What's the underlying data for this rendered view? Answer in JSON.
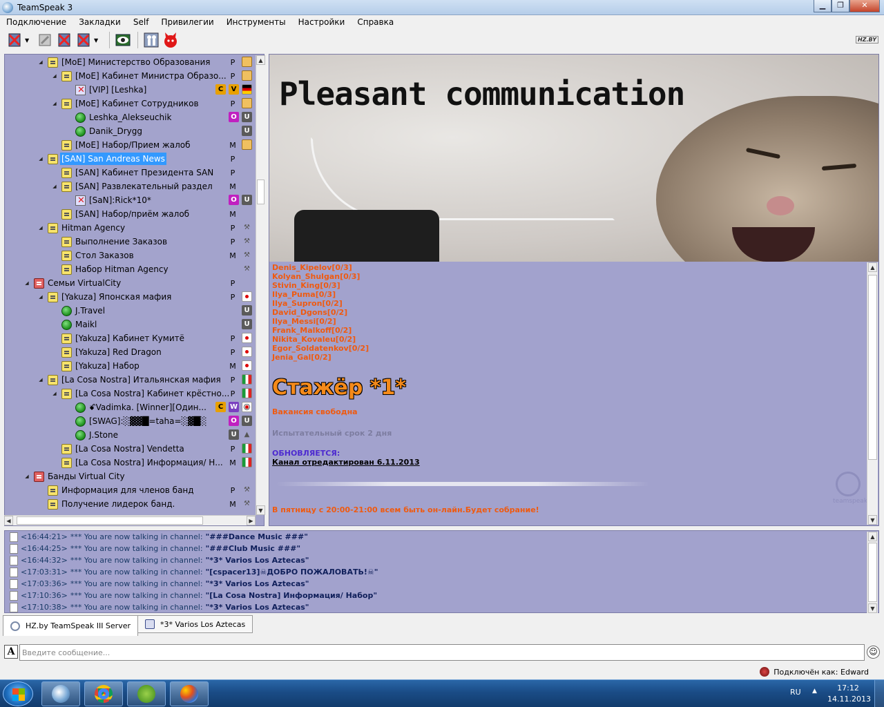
{
  "window": {
    "title": "TeamSpeak 3",
    "minimize": "▁",
    "maximize": "❐",
    "close": "✕"
  },
  "menu": [
    "Подключение",
    "Закладки",
    "Self",
    "Привилегии",
    "Инструменты",
    "Настройки",
    "Справка"
  ],
  "toolbar": {
    "logo_text": "HZ.BY"
  },
  "tree": [
    {
      "label": "[MoE] Министерство Образования",
      "type": "channel",
      "depth": 3,
      "expand": "open",
      "flag": "P",
      "badges": [
        "clip"
      ]
    },
    {
      "label": "[MoE] Кабинет Министра Образо...",
      "type": "channel",
      "depth": 4,
      "expand": "open",
      "flag": "P",
      "badges": [
        "clip"
      ]
    },
    {
      "label": "[VIP] [Leshka]",
      "type": "muted",
      "depth": 5,
      "expand": "",
      "flag": "",
      "badges": [
        "c",
        "v",
        "de"
      ]
    },
    {
      "label": "[MoE] Кабинет Сотрудников",
      "type": "channel",
      "depth": 4,
      "expand": "open",
      "flag": "P",
      "badges": [
        "clip"
      ]
    },
    {
      "label": "Leshka_Alekseuchik",
      "type": "user",
      "depth": 5,
      "expand": "",
      "flag": "",
      "badges": [
        "o",
        "u"
      ]
    },
    {
      "label": "Danik_Drygg",
      "type": "user",
      "depth": 5,
      "expand": "",
      "flag": "",
      "badges": [
        "u"
      ]
    },
    {
      "label": "[MoE] Набор/Прием жалоб",
      "type": "channel",
      "depth": 4,
      "expand": "",
      "flag": "M",
      "badges": [
        "clip"
      ]
    },
    {
      "label": "[SAN] San Andreas News",
      "type": "channel",
      "depth": 3,
      "expand": "open",
      "flag": "P",
      "badges": [],
      "selected": true
    },
    {
      "label": "[SAN] Кабинет Президента SAN",
      "type": "channel",
      "depth": 4,
      "expand": "",
      "flag": "P",
      "badges": []
    },
    {
      "label": "[SAN] Развлекательный раздел",
      "type": "channel",
      "depth": 4,
      "expand": "open",
      "flag": "M",
      "badges": []
    },
    {
      "label": "[SaN]:Rick*10*",
      "type": "muted",
      "depth": 5,
      "expand": "",
      "flag": "",
      "badges": [
        "o",
        "u"
      ]
    },
    {
      "label": "[SAN] Набор/приём жалоб",
      "type": "channel",
      "depth": 4,
      "expand": "",
      "flag": "M",
      "badges": []
    },
    {
      "label": "Hitman Agency",
      "type": "channel",
      "depth": 3,
      "expand": "open",
      "flag": "P",
      "badges": [
        "gun"
      ]
    },
    {
      "label": "Выполнение Заказов",
      "type": "channel",
      "depth": 4,
      "expand": "",
      "flag": "P",
      "badges": [
        "gun"
      ]
    },
    {
      "label": "Стол Заказов",
      "type": "channel",
      "depth": 4,
      "expand": "",
      "flag": "M",
      "badges": [
        "gun"
      ]
    },
    {
      "label": "Набор Hitman Agency",
      "type": "channel",
      "depth": 4,
      "expand": "",
      "flag": "",
      "badges": [
        "gun"
      ]
    },
    {
      "label": "Семьи VirtualCity",
      "type": "channel-red",
      "depth": 2,
      "expand": "open",
      "flag": "P",
      "badges": []
    },
    {
      "label": "[Yakuza] Японская мафия",
      "type": "channel",
      "depth": 3,
      "expand": "open",
      "flag": "P",
      "badges": [
        "jp"
      ]
    },
    {
      "label": "J.Travel",
      "type": "user",
      "depth": 4,
      "expand": "",
      "flag": "",
      "badges": [
        "u"
      ]
    },
    {
      "label": "Maikl",
      "type": "user",
      "depth": 4,
      "expand": "",
      "flag": "",
      "badges": [
        "u"
      ]
    },
    {
      "label": "[Yakuza] Кабинет Кумитё",
      "type": "channel",
      "depth": 4,
      "expand": "",
      "flag": "P",
      "badges": [
        "jp"
      ]
    },
    {
      "label": "[Yakuza] Red Dragon",
      "type": "channel",
      "depth": 4,
      "expand": "",
      "flag": "P",
      "badges": [
        "jp"
      ]
    },
    {
      "label": "[Yakuza] Набор",
      "type": "channel",
      "depth": 4,
      "expand": "",
      "flag": "M",
      "badges": [
        "jp"
      ]
    },
    {
      "label": "[La Cosa Nostra] Итальянская мафия",
      "type": "channel",
      "depth": 3,
      "expand": "open",
      "flag": "P",
      "badges": [
        "it"
      ]
    },
    {
      "label": "[La Cosa Nostra] Кабинет крёстно...",
      "type": "channel",
      "depth": 4,
      "expand": "open",
      "flag": "P",
      "badges": [
        "it"
      ]
    },
    {
      "label": "ꗄVadimka. [Winner][Один...",
      "type": "user",
      "depth": 5,
      "expand": "",
      "flag": "",
      "badges": [
        "c",
        "w",
        "smile"
      ]
    },
    {
      "label": "[SWAG]:░▓▓█=taha=░▓█░",
      "type": "user",
      "depth": 5,
      "expand": "",
      "flag": "",
      "badges": [
        "o",
        "u"
      ]
    },
    {
      "label": "J.Stone",
      "type": "user",
      "depth": 5,
      "expand": "",
      "flag": "",
      "badges": [
        "u",
        "warn"
      ]
    },
    {
      "label": "[La Cosa Nostra] Vendetta",
      "type": "channel",
      "depth": 4,
      "expand": "",
      "flag": "P",
      "badges": [
        "it"
      ]
    },
    {
      "label": "[La Cosa Nostra] Информация/ Н...",
      "type": "channel",
      "depth": 4,
      "expand": "",
      "flag": "M",
      "badges": [
        "it"
      ]
    },
    {
      "label": "Банды Virtual City",
      "type": "channel-red",
      "depth": 2,
      "expand": "open",
      "flag": "",
      "badges": []
    },
    {
      "label": "Информация для членов банд",
      "type": "channel",
      "depth": 3,
      "expand": "",
      "flag": "P",
      "badges": [
        "gun"
      ]
    },
    {
      "label": "Получение лидерок банд.",
      "type": "channel",
      "depth": 3,
      "expand": "",
      "flag": "M",
      "badges": [
        "gun"
      ]
    }
  ],
  "badge_text": {
    "o": "O",
    "u": "U",
    "c": "C",
    "v": "V",
    "w": "W",
    "gun": "⚒",
    "smile": "☺",
    "warn": "▲"
  },
  "info": {
    "banner_title": "Pleasant communication",
    "players": [
      "Denis_Kipelov[0/3]",
      "Kolyan_Shulgan[0/3]",
      "Stivin_King[0/3]",
      "Ilya_Puma[0/3]",
      "Ilya_Supron[0/2]",
      "David_Dgons[0/2]",
      "Ilya_Messi[0/2]",
      "Frank_Malkoff[0/2]",
      "Nikita_Kovaleu[0/2]",
      "Egor_Soldatenkov[0/2]",
      "Jenia_Gal[0/2]"
    ],
    "rank_title": "Стажёр *1*",
    "vacancy": "Вакансия свободна",
    "trial": "Испытательный срок 2 дня",
    "updated_label": "ОБНОВЛЯЕТСЯ:",
    "edited": "Канал отредактирован 6.11.2013",
    "friday": "В пятницу с 20:00-21:00 всем быть он-лайн.Будет собрание!",
    "watermark": "teamspeak"
  },
  "log": [
    {
      "time": "<16:44:21>",
      "msg": "*** You are now talking in channel:",
      "channel": "\"###Dance Music ###\""
    },
    {
      "time": "<16:44:25>",
      "msg": "*** You are now talking in channel:",
      "channel": "\"###Club Music ###\""
    },
    {
      "time": "<16:44:32>",
      "msg": "*** You are now talking in channel:",
      "channel": "\"*3* Varios Los Aztecas\""
    },
    {
      "time": "<17:03:31>",
      "msg": "*** You are now talking in channel:",
      "channel": "\"[cspacer13]☠ДОБРО ПОЖАЛОВАТЬ!☠\""
    },
    {
      "time": "<17:03:36>",
      "msg": "*** You are now talking in channel:",
      "channel": "\"*3* Varios Los Aztecas\""
    },
    {
      "time": "<17:10:36>",
      "msg": "*** You are now talking in channel:",
      "channel": "\"[La Cosa Nostra] Информация/ Набор\""
    },
    {
      "time": "<17:10:38>",
      "msg": "*** You are now talking in channel:",
      "channel": "\"*3* Varios Los Aztecas\""
    }
  ],
  "tabs": [
    {
      "label": "HZ.by TeamSpeak III Server",
      "icon": "server"
    },
    {
      "label": "*3* Varios Los Aztecas",
      "icon": "channel"
    }
  ],
  "input": {
    "placeholder": "Введите сообщение...",
    "format_label": "A",
    "emoji": "☺"
  },
  "status": {
    "text": "Подключён как: Edward"
  },
  "taskbar": {
    "lang": "RU",
    "tray_arrow": "▲",
    "time": "17:12",
    "date": "14.11.2013"
  }
}
